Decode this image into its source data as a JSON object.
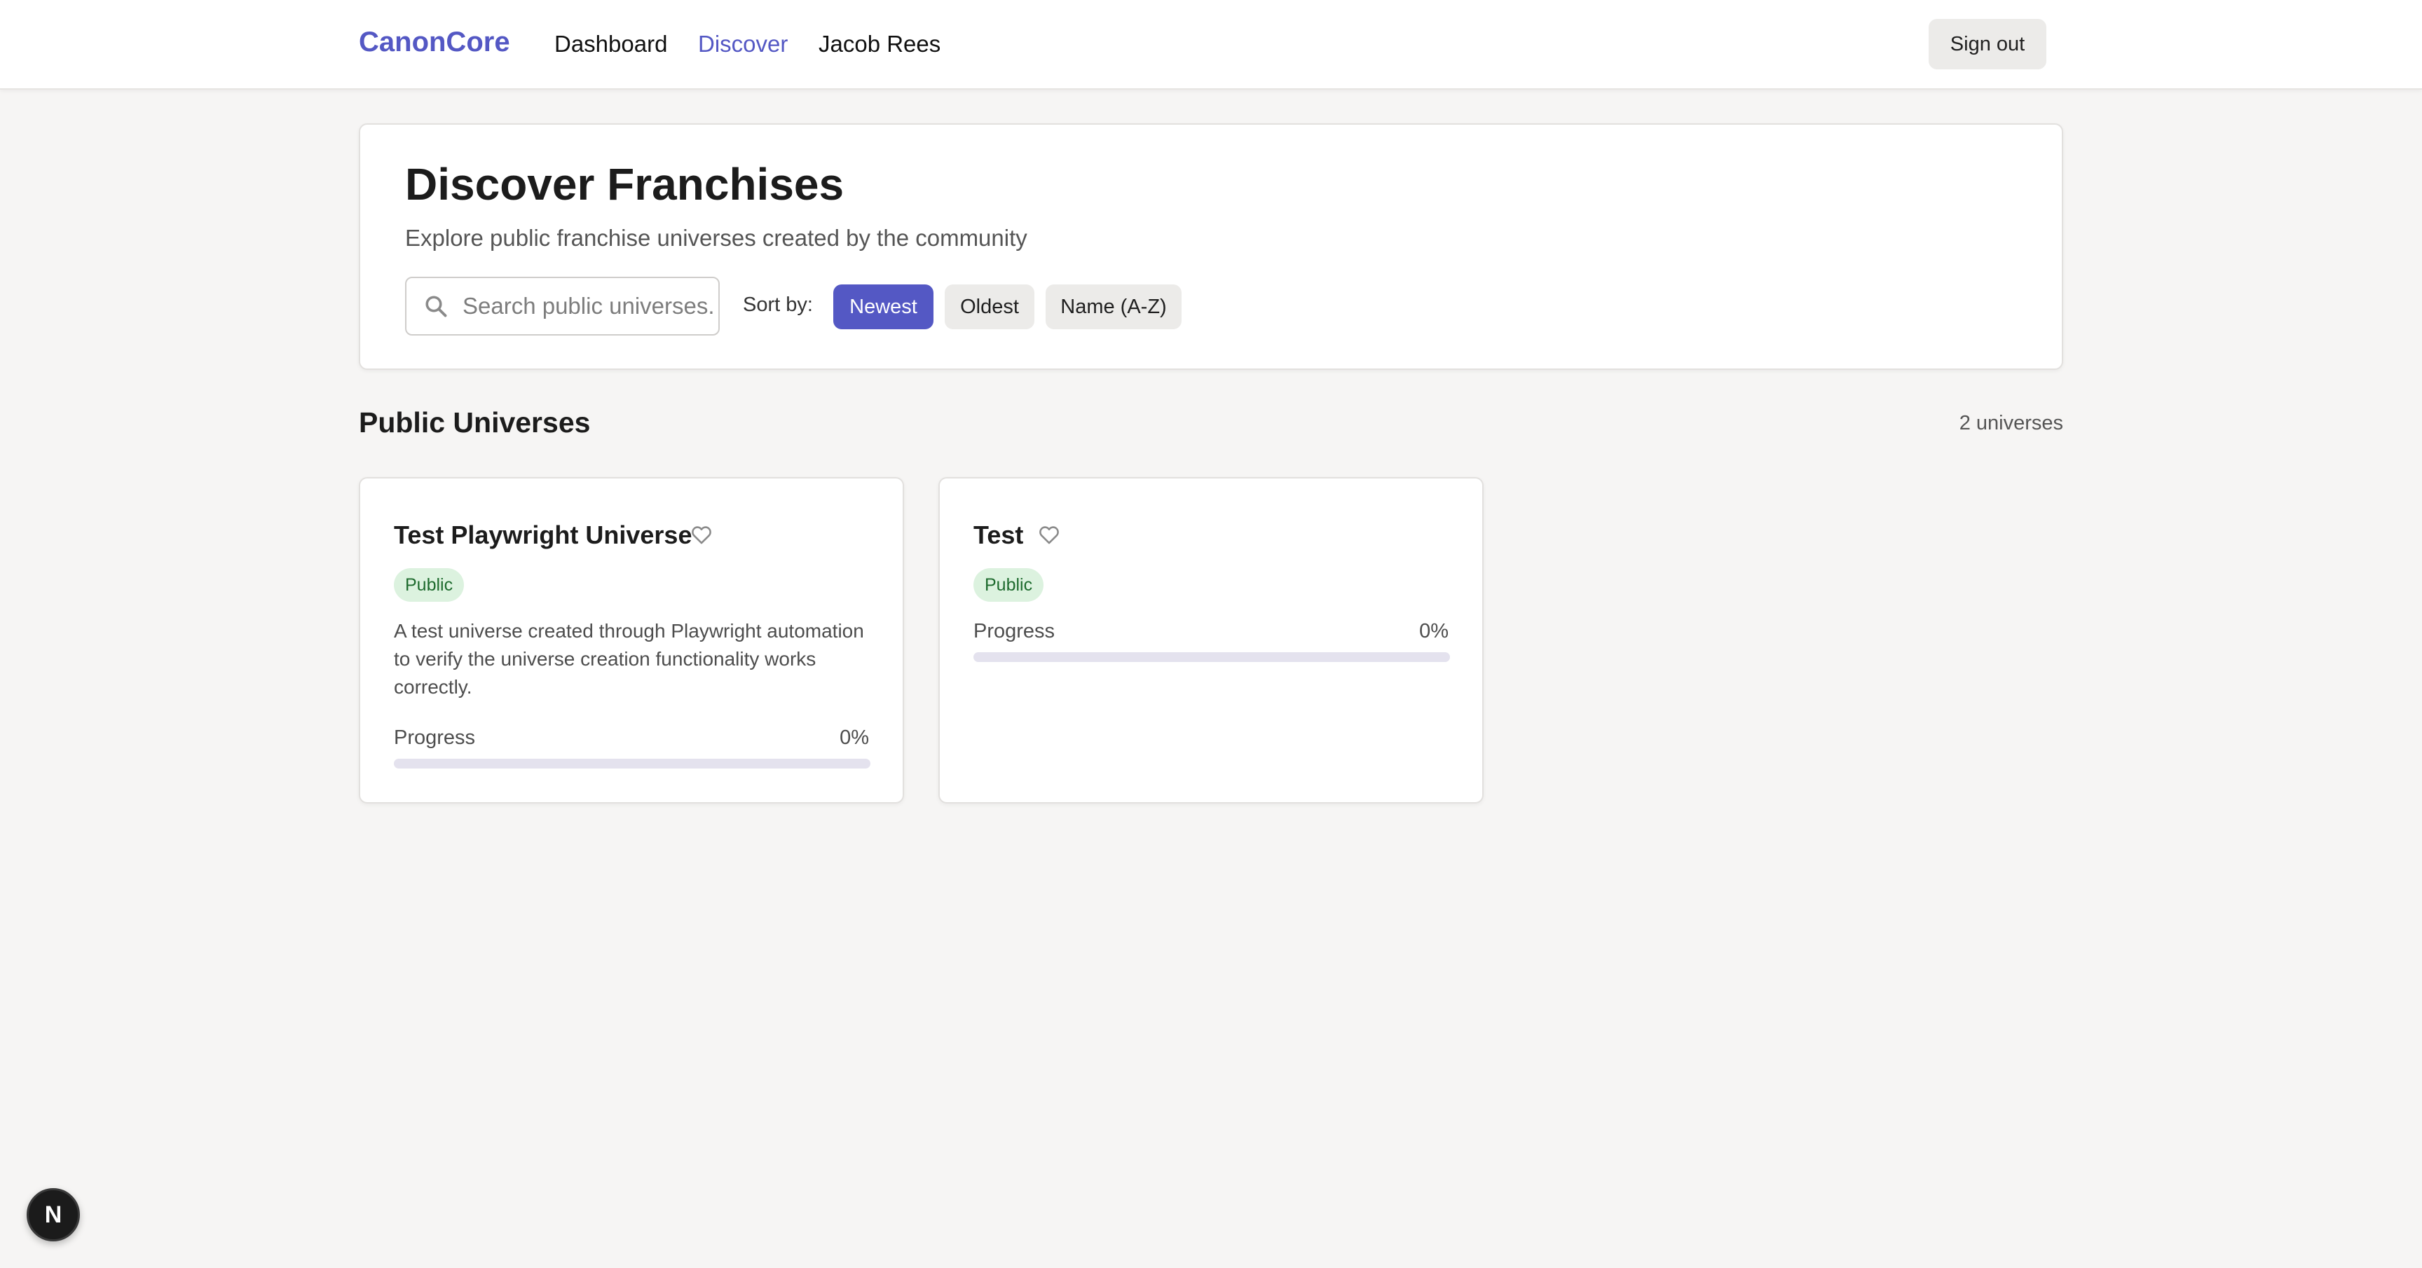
{
  "nav": {
    "brand": "CanonCore",
    "links": [
      {
        "label": "Dashboard",
        "active": false
      },
      {
        "label": "Discover",
        "active": true
      },
      {
        "label": "Jacob Rees",
        "active": false
      }
    ],
    "sign_out": "Sign out"
  },
  "hero": {
    "title": "Discover Franchises",
    "subtitle": "Explore public franchise universes created by the community",
    "search": {
      "placeholder": "Search public universes...",
      "value": ""
    },
    "sort_label": "Sort by:",
    "sort_options": [
      {
        "label": "Newest",
        "selected": true
      },
      {
        "label": "Oldest",
        "selected": false
      },
      {
        "label": "Name (A-Z)",
        "selected": false
      }
    ]
  },
  "section": {
    "title": "Public Universes",
    "count": "2 universes"
  },
  "universes": [
    {
      "title": "Test Playwright Universe",
      "badge": "Public",
      "description": "A test universe created through Playwright automation to verify the universe creation functionality works correctly.",
      "progress_label": "Progress",
      "progress_text": "0%",
      "progress_fraction": 0
    },
    {
      "title": "Test",
      "badge": "Public",
      "description": "",
      "progress_label": "Progress",
      "progress_text": "0%",
      "progress_fraction": 0
    }
  ],
  "dev_indicator": "N",
  "colors": {
    "accent": "#5458c4",
    "page_background": "#f6f5f4",
    "badge_background": "#dcf2df",
    "badge_text": "#1e6b2e",
    "progress_track": "#e4e2ee"
  },
  "icons": [
    "search-icon",
    "heart-outline-icon"
  ]
}
